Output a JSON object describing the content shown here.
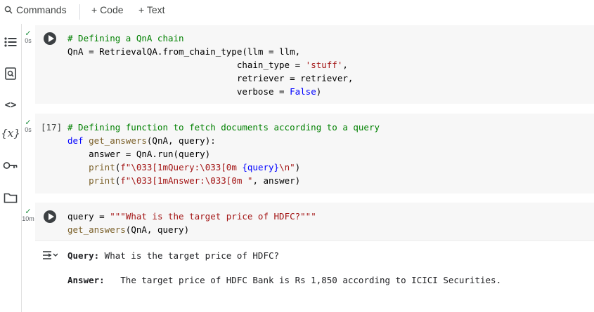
{
  "toolbar": {
    "commands_label": "Commands",
    "code_label": "+ Code",
    "text_label": "+ Text"
  },
  "sidebar": {
    "items": [
      {
        "icon": "table-of-contents-icon"
      },
      {
        "icon": "find-icon"
      },
      {
        "icon": "code-snippets-icon"
      },
      {
        "icon": "variables-icon",
        "label": "{x}"
      },
      {
        "icon": "secrets-key-icon"
      },
      {
        "icon": "files-folder-icon"
      }
    ]
  },
  "cells": [
    {
      "status_time": "0s",
      "exec_count": "",
      "lines": {
        "l1": "# Defining a QnA chain",
        "l2a": "QnA = RetrievalQA.from_chain_type(llm = llm,",
        "l3a": "chain_type = ",
        "l3b": "'stuff'",
        "l3c": ",",
        "l4": "retriever = retriever,",
        "l5a": "verbose = ",
        "l5b": "False",
        "l5c": ")"
      }
    },
    {
      "status_time": "0s",
      "exec_count": "[17]",
      "lines": {
        "l1": "# Defining function to fetch documents according to a query",
        "l2a": "def",
        "l2b": " ",
        "l2c": "get_answers",
        "l2d": "(QnA, query):",
        "l3": "answer = QnA.run(query)",
        "l4a": "print",
        "l4b": "(",
        "l4c": "f\"\\033[1mQuery:\\033[0m ",
        "l4d": "{query}",
        "l4e": "\\n\"",
        "l4f": ")",
        "l5a": "print",
        "l5b": "(",
        "l5c": "f\"\\033[1mAnswer:\\033[0m \"",
        "l5d": ", answer)"
      }
    },
    {
      "status_time": "10m",
      "exec_count": "",
      "lines": {
        "l1a": "query = ",
        "l1b": "\"\"\"What is the target price of HDFC?\"\"\"",
        "l2a": "get_answers",
        "l2b": "(QnA, query)"
      }
    }
  ],
  "output": {
    "query_label": "Query:",
    "query_value": " What is the target price of HDFC?",
    "answer_label": "Answer:",
    "answer_value": "   The target price of HDFC Bank is Rs 1,850 according to ICICI Securities."
  },
  "colors": {
    "comment": "#008000",
    "keyword": "#0000ff",
    "string": "#a31515",
    "function": "#795e26",
    "check": "#1e8e3e"
  }
}
